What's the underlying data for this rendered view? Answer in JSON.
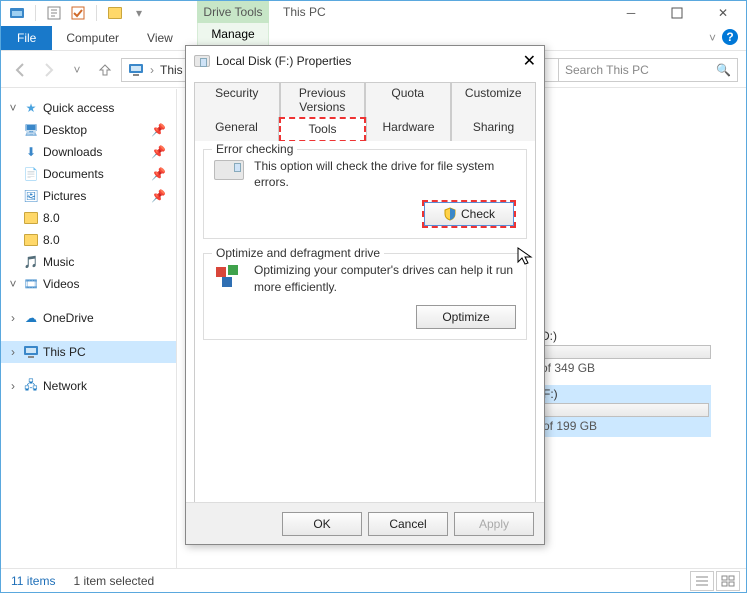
{
  "window": {
    "title": "This PC",
    "contextual_group": "Drive Tools",
    "contextual_tab": "Manage",
    "tabs": {
      "file": "File",
      "computer": "Computer",
      "view": "View"
    },
    "address_text": "This P",
    "search_placeholder": "Search This PC"
  },
  "nav": {
    "quick_access": {
      "label": "Quick access",
      "items": [
        {
          "label": "Desktop",
          "pinned": true
        },
        {
          "label": "Downloads",
          "pinned": true
        },
        {
          "label": "Documents",
          "pinned": true
        },
        {
          "label": "Pictures",
          "pinned": true
        },
        {
          "label": "8.0",
          "pinned": false
        },
        {
          "label": "8.0",
          "pinned": false
        },
        {
          "label": "Music",
          "pinned": false
        },
        {
          "label": "Videos",
          "pinned": false
        }
      ]
    },
    "onedrive": "OneDrive",
    "this_pc": "This PC",
    "network": "Network"
  },
  "content_fragments": {
    "d_label": "D:)",
    "d_free": "of 349 GB",
    "f_label": "F:)",
    "f_free": "of 199 GB"
  },
  "status": {
    "items": "11 items",
    "selected": "1 item selected"
  },
  "dialog": {
    "title": "Local Disk (F:) Properties",
    "tabs_row1": [
      "Security",
      "Previous Versions",
      "Quota",
      "Customize"
    ],
    "tabs_row2": [
      "General",
      "Tools",
      "Hardware",
      "Sharing"
    ],
    "active_tab": "Tools",
    "error_checking": {
      "legend": "Error checking",
      "text": "This option will check the drive for file system errors.",
      "button": "Check"
    },
    "optimize": {
      "legend": "Optimize and defragment drive",
      "text": "Optimizing your computer's drives can help it run more efficiently.",
      "button": "Optimize"
    },
    "buttons": {
      "ok": "OK",
      "cancel": "Cancel",
      "apply": "Apply"
    }
  }
}
